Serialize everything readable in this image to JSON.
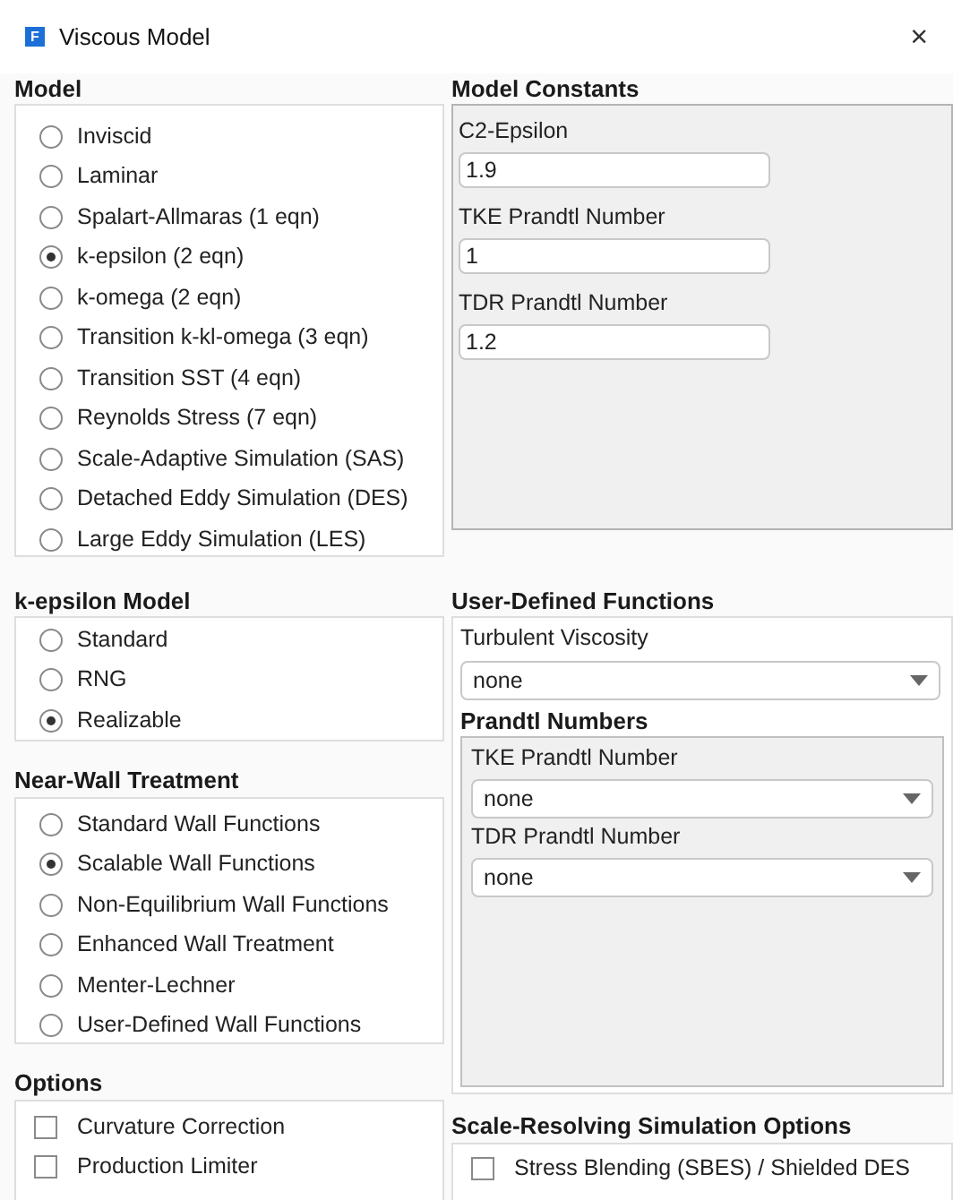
{
  "window": {
    "icon_text": "F",
    "title": "Viscous Model",
    "close": "×"
  },
  "model": {
    "title": "Model",
    "options": [
      {
        "label": "Inviscid",
        "selected": false
      },
      {
        "label": "Laminar",
        "selected": false
      },
      {
        "label": "Spalart-Allmaras (1 eqn)",
        "selected": false
      },
      {
        "label": "k-epsilon (2 eqn)",
        "selected": true
      },
      {
        "label": "k-omega (2 eqn)",
        "selected": false
      },
      {
        "label": "Transition k-kl-omega (3 eqn)",
        "selected": false
      },
      {
        "label": "Transition SST (4 eqn)",
        "selected": false
      },
      {
        "label": "Reynolds Stress (7 eqn)",
        "selected": false
      },
      {
        "label": "Scale-Adaptive Simulation (SAS)",
        "selected": false
      },
      {
        "label": "Detached Eddy Simulation (DES)",
        "selected": false
      },
      {
        "label": "Large Eddy Simulation (LES)",
        "selected": false
      }
    ]
  },
  "model_constants": {
    "title": "Model Constants",
    "fields": [
      {
        "label": "C2-Epsilon",
        "value": "1.9"
      },
      {
        "label": "TKE Prandtl Number",
        "value": "1"
      },
      {
        "label": "TDR Prandtl Number",
        "value": "1.2"
      }
    ]
  },
  "k_epsilon_model": {
    "title": "k-epsilon Model",
    "options": [
      {
        "label": "Standard",
        "selected": false
      },
      {
        "label": "RNG",
        "selected": false
      },
      {
        "label": "Realizable",
        "selected": true
      }
    ]
  },
  "user_defined_functions": {
    "title": "User-Defined Functions",
    "turbulent_viscosity": {
      "label": "Turbulent Viscosity",
      "value": "none"
    },
    "prandtl_numbers": {
      "title": "Prandtl Numbers",
      "fields": [
        {
          "label": "TKE Prandtl Number",
          "value": "none"
        },
        {
          "label": "TDR Prandtl Number",
          "value": "none"
        }
      ]
    }
  },
  "near_wall_treatment": {
    "title": "Near-Wall Treatment",
    "options": [
      {
        "label": "Standard Wall Functions",
        "selected": false
      },
      {
        "label": "Scalable Wall Functions",
        "selected": true
      },
      {
        "label": "Non-Equilibrium Wall Functions",
        "selected": false
      },
      {
        "label": "Enhanced Wall Treatment",
        "selected": false
      },
      {
        "label": "Menter-Lechner",
        "selected": false
      },
      {
        "label": "User-Defined Wall Functions",
        "selected": false
      }
    ]
  },
  "options": {
    "title": "Options",
    "items": [
      {
        "label": "Curvature Correction",
        "checked": false
      },
      {
        "label": "Production Limiter",
        "checked": false
      }
    ]
  },
  "scale_resolving_simulation_options": {
    "title": "Scale-Resolving Simulation Options",
    "items": [
      {
        "label": "Stress Blending (SBES) / Shielded DES",
        "checked": false
      }
    ]
  }
}
